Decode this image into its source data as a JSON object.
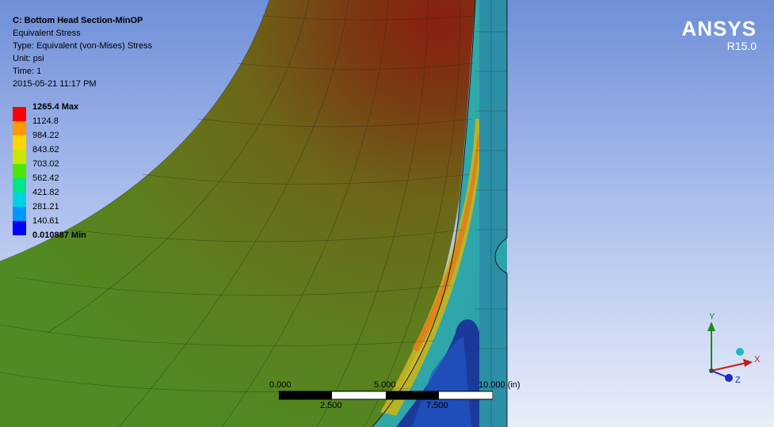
{
  "info": {
    "title": "C: Bottom Head Section-MinOP",
    "line1": "Equivalent Stress",
    "line2": "Type: Equivalent (von-Mises) Stress",
    "line3": "Unit: psi",
    "line4": "Time: 1",
    "line5": "2015-05-21 11:17 PM"
  },
  "legend": {
    "max_label": "1265.4 Max",
    "min_label": "0.010887 Min",
    "values": [
      "1124.8",
      "984.22",
      "843.62",
      "703.02",
      "562.42",
      "421.82",
      "281.21",
      "140.61"
    ],
    "colors": [
      "#ff0000",
      "#ff9900",
      "#ffd700",
      "#c8e600",
      "#4ce600",
      "#00e68a",
      "#00d2e6",
      "#0096ff",
      "#0000ff"
    ]
  },
  "brand": {
    "name": "ANSYS",
    "version": "R15.0"
  },
  "scale_bar": {
    "l0": "0.000",
    "l1": "2.500",
    "l2": "5.000",
    "l3": "7.500",
    "l4": "10.000 (in)"
  },
  "triad": {
    "y": "Y",
    "x": "X",
    "z": "Z"
  }
}
